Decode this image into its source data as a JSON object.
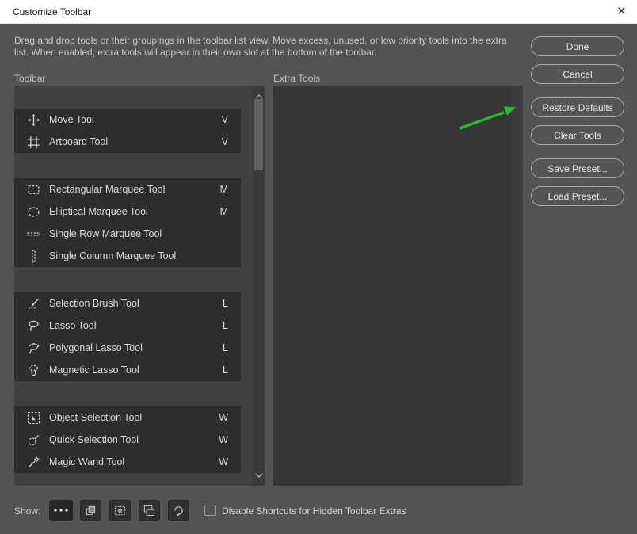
{
  "window": {
    "title": "Customize Toolbar",
    "close_icon": "×"
  },
  "description": "Drag and drop tools or their groupings in the toolbar list view. Move excess, unused, or low priority tools into the extra list. When enabled, extra tools will appear in their own slot at the bottom of the toolbar.",
  "panels": {
    "toolbar_label": "Toolbar",
    "extra_tools_label": "Extra Tools"
  },
  "buttons": {
    "done": "Done",
    "cancel": "Cancel",
    "restore_defaults": "Restore Defaults",
    "clear_tools": "Clear Tools",
    "save_preset": "Save Preset...",
    "load_preset": "Load Preset..."
  },
  "toolbar_groups": [
    {
      "items": [
        {
          "icon": "move-tool-icon",
          "label": "Move Tool",
          "shortcut": "V"
        },
        {
          "icon": "artboard-tool-icon",
          "label": "Artboard Tool",
          "shortcut": "V"
        }
      ]
    },
    {
      "items": [
        {
          "icon": "rectangular-marquee-icon",
          "label": "Rectangular Marquee Tool",
          "shortcut": "M"
        },
        {
          "icon": "elliptical-marquee-icon",
          "label": "Elliptical Marquee Tool",
          "shortcut": "M"
        },
        {
          "icon": "single-row-marquee-icon",
          "label": "Single Row Marquee Tool",
          "shortcut": ""
        },
        {
          "icon": "single-column-marquee-icon",
          "label": "Single Column Marquee Tool",
          "shortcut": ""
        }
      ]
    },
    {
      "items": [
        {
          "icon": "selection-brush-icon",
          "label": "Selection Brush Tool",
          "shortcut": "L"
        },
        {
          "icon": "lasso-icon",
          "label": "Lasso Tool",
          "shortcut": "L"
        },
        {
          "icon": "polygonal-lasso-icon",
          "label": "Polygonal Lasso Tool",
          "shortcut": "L"
        },
        {
          "icon": "magnetic-lasso-icon",
          "label": "Magnetic Lasso Tool",
          "shortcut": "L"
        }
      ]
    },
    {
      "items": [
        {
          "icon": "object-selection-icon",
          "label": "Object Selection Tool",
          "shortcut": "W"
        },
        {
          "icon": "quick-selection-icon",
          "label": "Quick Selection Tool",
          "shortcut": "W"
        },
        {
          "icon": "magic-wand-icon",
          "label": "Magic Wand Tool",
          "shortcut": "W"
        }
      ]
    }
  ],
  "footer": {
    "show_label": "Show:",
    "checkbox_label": "Disable Shortcuts for Hidden Toolbar Extras",
    "checkbox_checked": false
  },
  "colors": {
    "dialog_bg": "#535353",
    "group_bg": "#2d2d2d",
    "panel_bg": "#414141",
    "annotation_green": "#25bc25"
  }
}
